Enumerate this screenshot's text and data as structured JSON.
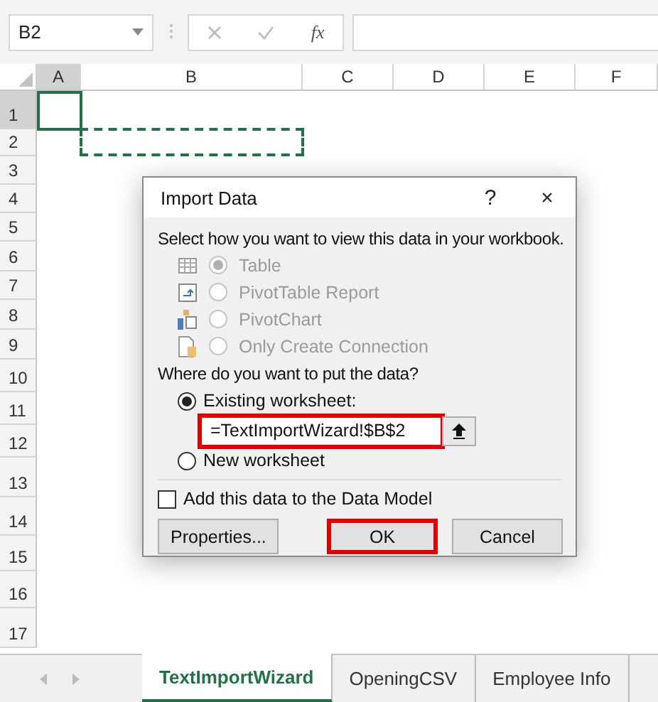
{
  "name_box": {
    "value": "B2"
  },
  "formula_bar": {
    "fx_label": "fx"
  },
  "columns": [
    {
      "label": "A",
      "selected": true
    },
    {
      "label": "B",
      "selected": false
    },
    {
      "label": "C",
      "selected": false
    },
    {
      "label": "D",
      "selected": false
    },
    {
      "label": "E",
      "selected": false
    },
    {
      "label": "F",
      "selected": false
    }
  ],
  "rows": [
    {
      "label": "1",
      "selected": true
    },
    {
      "label": "2",
      "selected": false
    },
    {
      "label": "3",
      "selected": false
    },
    {
      "label": "4",
      "selected": false
    },
    {
      "label": "5",
      "selected": false
    },
    {
      "label": "6",
      "selected": false
    },
    {
      "label": "7",
      "selected": false
    },
    {
      "label": "8",
      "selected": false
    },
    {
      "label": "9",
      "selected": false
    },
    {
      "label": "10",
      "selected": false
    },
    {
      "label": "11",
      "selected": false
    },
    {
      "label": "12",
      "selected": false
    },
    {
      "label": "13",
      "selected": false
    },
    {
      "label": "14",
      "selected": false
    },
    {
      "label": "15",
      "selected": false
    },
    {
      "label": "16",
      "selected": false
    },
    {
      "label": "17",
      "selected": false
    }
  ],
  "dialog": {
    "title": "Import Data",
    "help": "?",
    "close": "×",
    "view_prompt": "Select how you want to view this data in your workbook.",
    "view_options": [
      {
        "label": "Table",
        "kind": "table",
        "selected": true,
        "disabled": true
      },
      {
        "label": "PivotTable Report",
        "kind": "pivottable",
        "selected": false,
        "disabled": true
      },
      {
        "label": "PivotChart",
        "kind": "pivotchart",
        "selected": false,
        "disabled": true
      },
      {
        "label": "Only Create Connection",
        "kind": "connection",
        "selected": false,
        "disabled": true
      }
    ],
    "place_prompt": "Where do you want to put the data?",
    "place_options": [
      {
        "label": "Existing worksheet:",
        "selected": true
      },
      {
        "label": "New worksheet",
        "selected": false
      }
    ],
    "location_field": {
      "value": "=TextImportWizard!$B$2",
      "highlighted": true
    },
    "data_model": {
      "label": "Add this data to the Data Model",
      "checked": false
    },
    "buttons": [
      {
        "label": "Properties...",
        "highlighted": false
      },
      {
        "label": "OK",
        "highlighted": true
      },
      {
        "label": "Cancel",
        "highlighted": false
      }
    ]
  },
  "sheet_tabs": [
    {
      "label": "TextImportWizard",
      "selected": true
    },
    {
      "label": "OpeningCSV",
      "selected": false
    },
    {
      "label": "Employee Info",
      "selected": false
    }
  ]
}
